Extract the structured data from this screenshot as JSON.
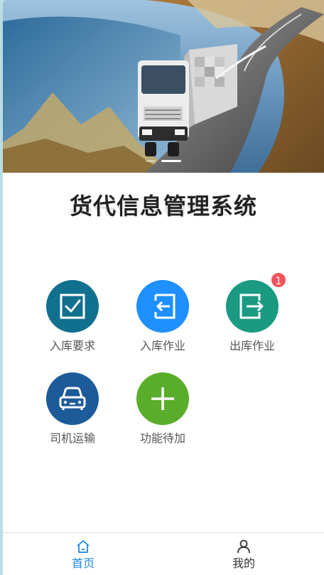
{
  "banner": {
    "slide_count": 2,
    "active_slide": 2
  },
  "app": {
    "title": "货代信息管理系统"
  },
  "menu": [
    {
      "label": "入库要求",
      "icon": "checkbox-icon",
      "color": "#12708f"
    },
    {
      "label": "入库作业",
      "icon": "import-arrow-icon",
      "color": "#1e90ff"
    },
    {
      "label": "出库作业",
      "icon": "export-arrow-icon",
      "color": "#1b9a82",
      "badge": "1"
    },
    {
      "label": "司机运输",
      "icon": "car-icon",
      "color": "#1d5a99"
    },
    {
      "label": "功能待加",
      "icon": "plus-icon",
      "color": "#5aad2a"
    }
  ],
  "tabbar": {
    "home": {
      "label": "首页",
      "icon": "home-icon",
      "active": true
    },
    "mine": {
      "label": "我的",
      "icon": "user-icon",
      "active": false
    }
  },
  "colors": {
    "accent": "#1e88e5",
    "badge": "#f2545b"
  }
}
